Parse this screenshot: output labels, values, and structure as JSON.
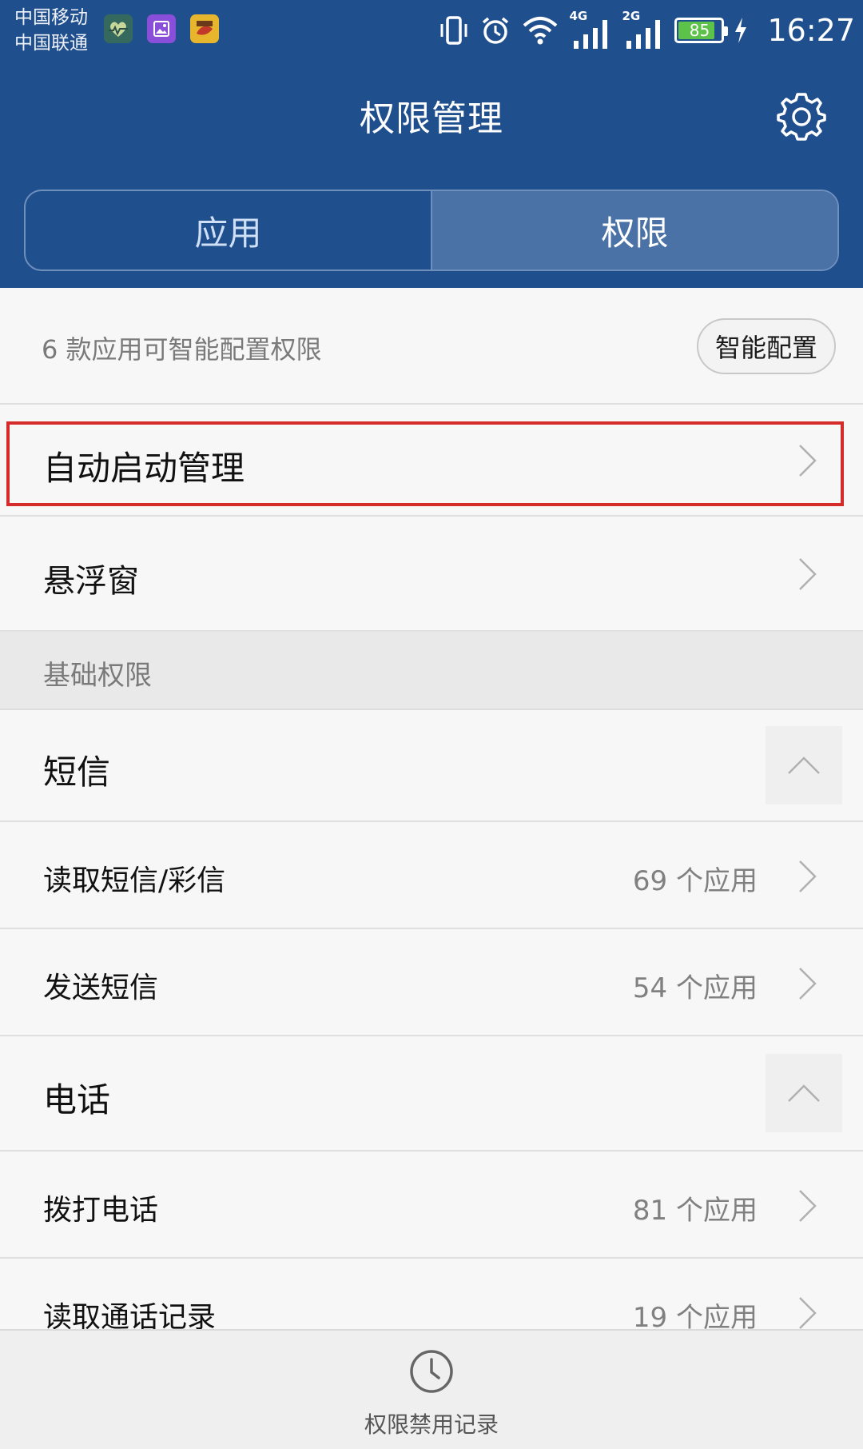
{
  "status_bar": {
    "carrier_1": "中国移动",
    "carrier_2": "中国联通",
    "network_1": "4G",
    "network_2": "2G",
    "battery": "85",
    "battery_level": 0.85,
    "time": "16:27",
    "notification_icons": [
      "health-app-icon",
      "gallery-app-icon",
      "game-app-icon"
    ],
    "status_icons": [
      "vibrate-icon",
      "alarm-icon",
      "wifi-icon",
      "signal-icon",
      "signal-icon",
      "battery-icon",
      "charging-icon"
    ]
  },
  "header": {
    "title": "权限管理",
    "settings_icon": "gear-icon",
    "color": "#204f8e"
  },
  "tabs": [
    {
      "label": "应用",
      "active": false
    },
    {
      "label": "权限",
      "active": true
    }
  ],
  "smart_config": {
    "text": "6 款应用可智能配置权限",
    "button_label": "智能配置"
  },
  "top_items": [
    {
      "label": "自动启动管理",
      "highlighted": true
    },
    {
      "label": "悬浮窗",
      "highlighted": false
    }
  ],
  "section": {
    "title": "基础权限"
  },
  "groups": [
    {
      "name": "短信",
      "expanded": true,
      "items": [
        {
          "label": "读取短信/彩信",
          "count": "69 个应用"
        },
        {
          "label": "发送短信",
          "count": "54 个应用"
        }
      ]
    },
    {
      "name": "电话",
      "expanded": true,
      "items": [
        {
          "label": "拨打电话",
          "count": "81 个应用"
        },
        {
          "label": "读取通话记录",
          "count": "19 个应用"
        }
      ]
    }
  ],
  "bottom_bar": {
    "label": "权限禁用记录",
    "icon": "clock-icon"
  },
  "colors": {
    "accent": "#204f8e",
    "highlight_border": "#d62b2b",
    "battery": "#5cc24a"
  }
}
